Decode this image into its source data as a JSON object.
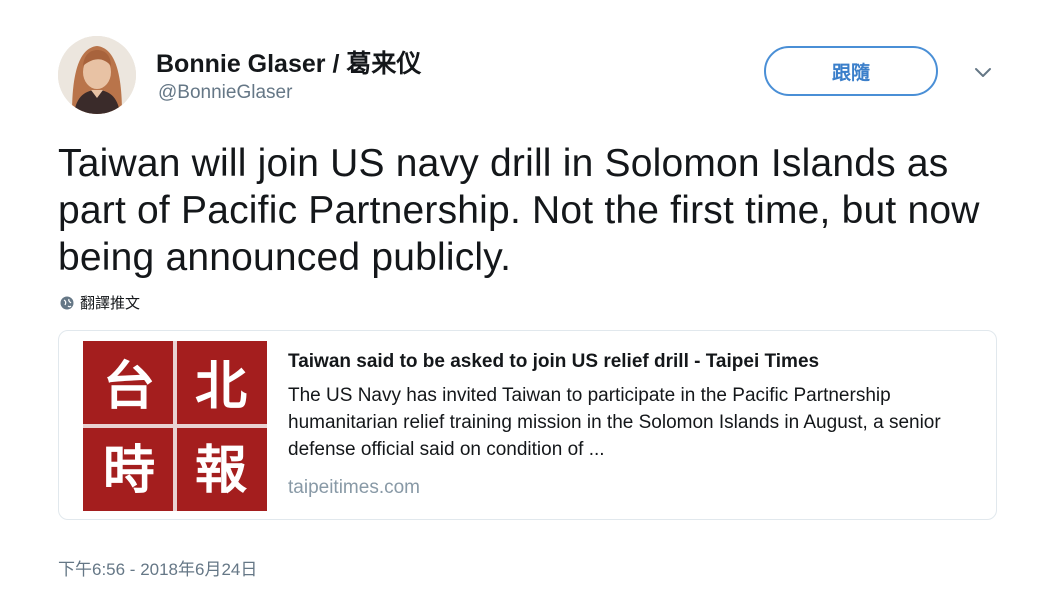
{
  "user": {
    "display_name": "Bonnie Glaser / 葛来仪",
    "handle": "@BonnieGlaser"
  },
  "follow_button": {
    "label": "跟隨",
    "color": "#3b7fca"
  },
  "menu_icon": "chevron-down-icon",
  "tweet": {
    "text": "Taiwan will join US navy drill in Solomon Islands as part of Pacific Partnership. Not the first time, but now being announced publicly.",
    "translate_label": "翻譯推文"
  },
  "card": {
    "image_characters": [
      "台",
      "北",
      "時",
      "報"
    ],
    "image_color": "#a41e1e",
    "title": "Taiwan said to be asked to join US relief drill - Taipei Times",
    "description": "The US Navy has invited Taiwan to participate in the Pacific Partnership humanitarian relief training mission in the Solomon Islands in August, a senior defense official said on condition of ...",
    "domain": "taipeitimes.com"
  },
  "timestamp": "下午6:56 - 2018年6月24日"
}
